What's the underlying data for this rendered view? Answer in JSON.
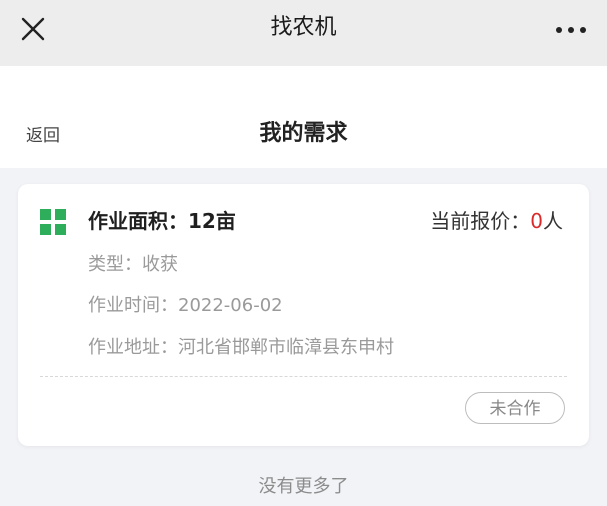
{
  "topbar": {
    "title": "找农机",
    "close_icon": "close-icon",
    "more_icon": "more-icon"
  },
  "navbar": {
    "back_label": "返回",
    "page_title": "我的需求"
  },
  "demand_card": {
    "area_label": "作业面积：",
    "area_value": "12亩",
    "quote_label": "当前报价：",
    "quote_count": "0",
    "quote_unit": "人",
    "type_label": "类型：",
    "type_value": "收获",
    "time_label": "作业时间：",
    "time_value": "2022-06-02",
    "address_label": "作业地址：",
    "address_value": "河北省邯郸市临漳县东申村",
    "status_label": "未合作",
    "icon": "farm-field-icon"
  },
  "footer": {
    "no_more_text": "没有更多了"
  },
  "colors": {
    "accent_green": "#2eae5b",
    "quote_red": "#d92b2b"
  }
}
